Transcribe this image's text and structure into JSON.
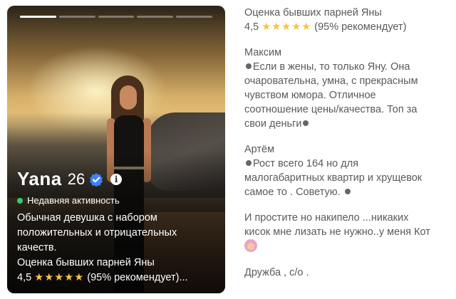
{
  "card": {
    "name": "Yana",
    "age": "26",
    "info_glyph": "i",
    "activity": "Недавняя активность",
    "bio": {
      "line1": "Обычная девушка  с набором",
      "line2": "положительных и отрицательных",
      "line3": "качеств.",
      "line4": "Оценка бывших парней Яны",
      "rating_num": "4,5",
      "stars": "★★★★★",
      "rating_rest": "(95% рекомендует)..."
    },
    "progress": {
      "total": 5,
      "active_index": 0
    }
  },
  "reviews": {
    "header": "Оценка бывших парней Яны",
    "rating_num": "4,5",
    "stars": "★★★★★",
    "rating_rest": "(95% рекомендует)",
    "r1": {
      "author": "Максим",
      "l1": "Если в жены, то только Яну. Она",
      "l2": "очаровательна, умна, с прекрасным",
      "l3": "чувством юмора. Отличное",
      "l4": "соотношение цены/качества. Топ за",
      "l5": "свои деньги"
    },
    "r2": {
      "author": "Артём",
      "l1": "Рост всего 164 но для",
      "l2": "малогабаритных квартир и хрущевок",
      "l3": "самое то . Советую."
    },
    "r3": {
      "l1": "И простите но накипело ...никаких",
      "l2": "кисок мне лизать не нужно..у меня Кот"
    },
    "r4": {
      "l1": "Дружба , с/о ."
    }
  },
  "colors": {
    "verified": "#3b82f6",
    "online": "#2fd26a",
    "star": "#f6c343",
    "text": "#5a5a5a"
  },
  "icons": [
    "verified-check-icon",
    "info-icon",
    "online-dot-icon",
    "star-icon",
    "bullet-dot-icon",
    "emoji-icon"
  ]
}
